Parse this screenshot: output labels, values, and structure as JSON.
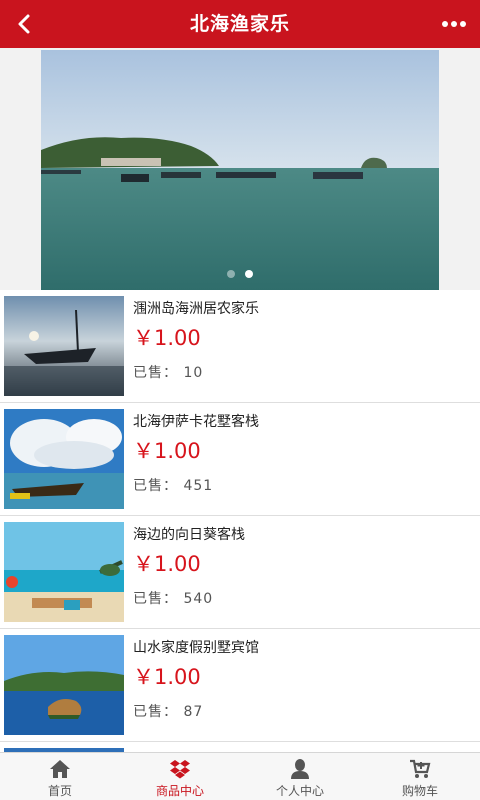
{
  "header": {
    "title": "北海渔家乐",
    "back_icon": "back-arrow-icon",
    "more_icon": "more-dots-icon"
  },
  "banner": {
    "slide_count": 2,
    "active_slide": 2
  },
  "products": [
    {
      "name": "涠洲岛海洲居农家乐",
      "price": "￥1.00",
      "sold": "已售： 10"
    },
    {
      "name": "北海伊萨卡花墅客栈",
      "price": "￥1.00",
      "sold": "已售： 451"
    },
    {
      "name": "海边的向日葵客栈",
      "price": "￥1.00",
      "sold": "已售： 540"
    },
    {
      "name": "山水家度假别墅宾馆",
      "price": "￥1.00",
      "sold": "已售： 87"
    }
  ],
  "tabs": [
    {
      "label": "首页",
      "icon": "home-icon",
      "active": false
    },
    {
      "label": "商品中心",
      "icon": "dropbox-icon",
      "active": true
    },
    {
      "label": "个人中心",
      "icon": "user-icon",
      "active": false
    },
    {
      "label": "购物车",
      "icon": "cart-icon",
      "active": false
    }
  ],
  "colors": {
    "brand": "#c9141e",
    "price": "#d7141c"
  }
}
